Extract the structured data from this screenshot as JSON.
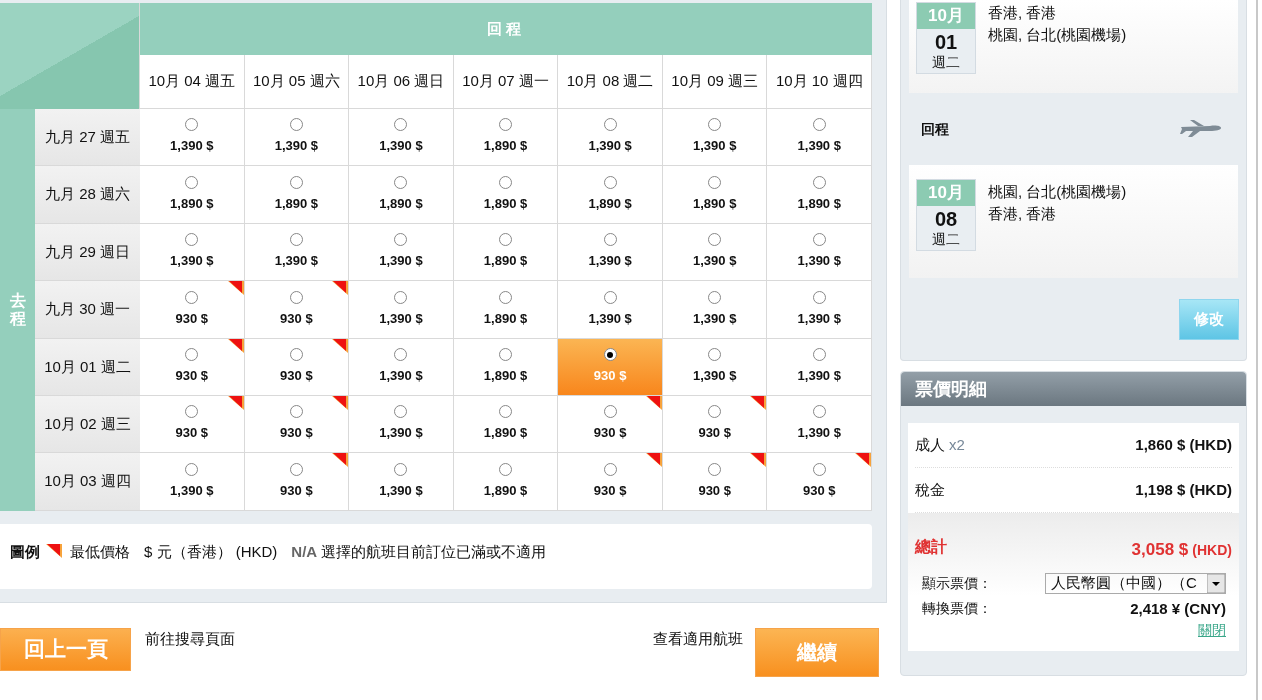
{
  "grid": {
    "return_title": "回程",
    "depart_title": "去程",
    "return_dates": [
      "10月 04 週五",
      "10月 05 週六",
      "10月 06 週日",
      "10月 07 週一",
      "10月 08 週二",
      "10月 09 週三",
      "10月 10 週四"
    ],
    "rows": [
      {
        "date": "九月 27 週五",
        "cells": [
          {
            "price": "1,390 $",
            "lowest": false,
            "selected": false
          },
          {
            "price": "1,390 $",
            "lowest": false,
            "selected": false
          },
          {
            "price": "1,390 $",
            "lowest": false,
            "selected": false
          },
          {
            "price": "1,890 $",
            "lowest": false,
            "selected": false
          },
          {
            "price": "1,390 $",
            "lowest": false,
            "selected": false
          },
          {
            "price": "1,390 $",
            "lowest": false,
            "selected": false
          },
          {
            "price": "1,390 $",
            "lowest": false,
            "selected": false
          }
        ]
      },
      {
        "date": "九月 28 週六",
        "cells": [
          {
            "price": "1,890 $",
            "lowest": false,
            "selected": false
          },
          {
            "price": "1,890 $",
            "lowest": false,
            "selected": false
          },
          {
            "price": "1,890 $",
            "lowest": false,
            "selected": false
          },
          {
            "price": "1,890 $",
            "lowest": false,
            "selected": false
          },
          {
            "price": "1,890 $",
            "lowest": false,
            "selected": false
          },
          {
            "price": "1,890 $",
            "lowest": false,
            "selected": false
          },
          {
            "price": "1,890 $",
            "lowest": false,
            "selected": false
          }
        ]
      },
      {
        "date": "九月 29 週日",
        "cells": [
          {
            "price": "1,390 $",
            "lowest": false,
            "selected": false
          },
          {
            "price": "1,390 $",
            "lowest": false,
            "selected": false
          },
          {
            "price": "1,390 $",
            "lowest": false,
            "selected": false
          },
          {
            "price": "1,890 $",
            "lowest": false,
            "selected": false
          },
          {
            "price": "1,390 $",
            "lowest": false,
            "selected": false
          },
          {
            "price": "1,390 $",
            "lowest": false,
            "selected": false
          },
          {
            "price": "1,390 $",
            "lowest": false,
            "selected": false
          }
        ]
      },
      {
        "date": "九月 30 週一",
        "cells": [
          {
            "price": "930 $",
            "lowest": true,
            "selected": false
          },
          {
            "price": "930 $",
            "lowest": true,
            "selected": false
          },
          {
            "price": "1,390 $",
            "lowest": false,
            "selected": false
          },
          {
            "price": "1,890 $",
            "lowest": false,
            "selected": false
          },
          {
            "price": "1,390 $",
            "lowest": false,
            "selected": false
          },
          {
            "price": "1,390 $",
            "lowest": false,
            "selected": false
          },
          {
            "price": "1,390 $",
            "lowest": false,
            "selected": false
          }
        ]
      },
      {
        "date": "10月 01 週二",
        "cells": [
          {
            "price": "930 $",
            "lowest": true,
            "selected": false
          },
          {
            "price": "930 $",
            "lowest": true,
            "selected": false
          },
          {
            "price": "1,390 $",
            "lowest": false,
            "selected": false
          },
          {
            "price": "1,890 $",
            "lowest": false,
            "selected": false
          },
          {
            "price": "930 $",
            "lowest": false,
            "selected": true
          },
          {
            "price": "1,390 $",
            "lowest": false,
            "selected": false
          },
          {
            "price": "1,390 $",
            "lowest": false,
            "selected": false
          }
        ]
      },
      {
        "date": "10月 02 週三",
        "cells": [
          {
            "price": "930 $",
            "lowest": true,
            "selected": false
          },
          {
            "price": "930 $",
            "lowest": true,
            "selected": false
          },
          {
            "price": "1,390 $",
            "lowest": false,
            "selected": false
          },
          {
            "price": "1,890 $",
            "lowest": false,
            "selected": false
          },
          {
            "price": "930 $",
            "lowest": true,
            "selected": false
          },
          {
            "price": "930 $",
            "lowest": true,
            "selected": false
          },
          {
            "price": "1,390 $",
            "lowest": false,
            "selected": false
          }
        ]
      },
      {
        "date": "10月 03 週四",
        "cells": [
          {
            "price": "1,390 $",
            "lowest": false,
            "selected": false
          },
          {
            "price": "930 $",
            "lowest": true,
            "selected": false
          },
          {
            "price": "1,390 $",
            "lowest": false,
            "selected": false
          },
          {
            "price": "1,890 $",
            "lowest": false,
            "selected": false
          },
          {
            "price": "930 $",
            "lowest": true,
            "selected": false
          },
          {
            "price": "930 $",
            "lowest": true,
            "selected": false
          },
          {
            "price": "930 $",
            "lowest": true,
            "selected": false
          }
        ]
      }
    ]
  },
  "legend": {
    "title": "圖例",
    "lowest_label": "最低價格",
    "currency": "$ 元（香港） (HKD)",
    "na_code": "N/A",
    "na_text": "選擇的航班目前訂位已滿或不適用"
  },
  "footer": {
    "back_button": "回上一頁",
    "back_text": "前往搜尋頁面",
    "view_text": "查看適用航班",
    "continue_button": "繼續"
  },
  "itinerary": {
    "outbound": {
      "month": "10月",
      "day": "01",
      "weekday": "週二",
      "from": "香港, 香港",
      "to": "桃園, 台北(桃園機場)"
    },
    "return_label": "回程",
    "return": {
      "month": "10月",
      "day": "08",
      "weekday": "週二",
      "from": "桃園, 台北(桃園機場)",
      "to": "香港, 香港"
    },
    "modify_button": "修改"
  },
  "price_details": {
    "title": "票價明細",
    "rows": [
      {
        "label": "成人",
        "qty": "x2",
        "amount": "1,860 $ (HKD)"
      },
      {
        "label": "稅金",
        "amount": "1,198 $ (HKD)"
      }
    ],
    "total_label": "總計",
    "total_amount": "3,058 $",
    "total_currency": "(HKD)",
    "display_label": "顯示票價：",
    "display_value": "人民幣圓（中國）（C",
    "converted_label": "轉換票價：",
    "converted_amount": "2,418 ¥ (CNY)",
    "close_link": "關閉"
  }
}
